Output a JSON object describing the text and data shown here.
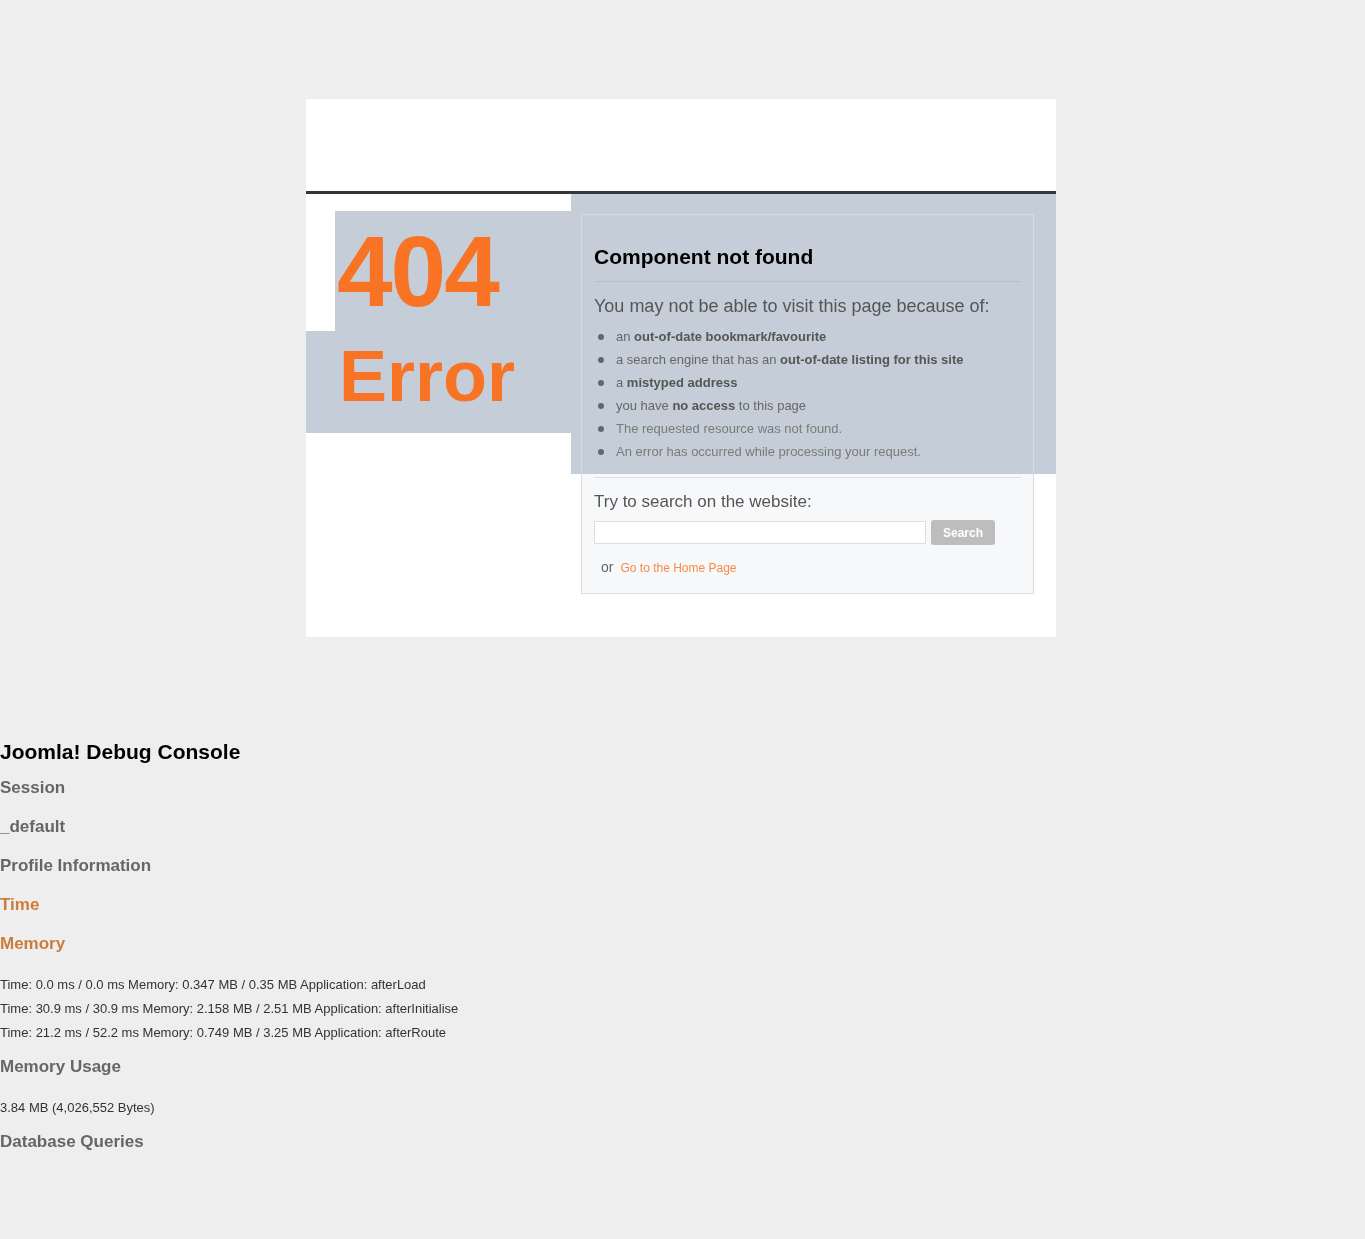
{
  "error": {
    "code": "404",
    "label": "Error"
  },
  "panel": {
    "title": "Component not found",
    "intro": "You may not be able to visit this page because of:",
    "reasons": [
      "an **out-of-date bookmark/favourite**",
      "a search engine that has an **out-of-date listing for this site**",
      "a **mistyped address**",
      "you have **no access** to this page",
      "The requested resource was not found.",
      "An error has occurred while processing your request."
    ],
    "search_prompt": "Try to search on the website:",
    "search_button": "Search",
    "or": "or",
    "home_link": "Go to the Home Page"
  },
  "debug": {
    "title": "Joomla! Debug Console",
    "items": [
      {
        "kind": "heading",
        "text": "Session"
      },
      {
        "kind": "heading",
        "text": "_default"
      },
      {
        "kind": "heading",
        "text": "Profile Information"
      },
      {
        "kind": "link",
        "text": "Time"
      },
      {
        "kind": "link",
        "text": "Memory"
      },
      {
        "kind": "line",
        "text": "Time: 0.0 ms / 0.0 ms Memory: 0.347 MB / 0.35 MB Application: afterLoad"
      },
      {
        "kind": "line",
        "text": "Time: 30.9 ms / 30.9 ms Memory: 2.158 MB / 2.51 MB Application: afterInitialise"
      },
      {
        "kind": "line",
        "text": "Time: 21.2 ms / 52.2 ms Memory: 0.749 MB / 3.25 MB Application: afterRoute"
      },
      {
        "kind": "heading",
        "text": "Memory Usage"
      },
      {
        "kind": "line",
        "text": "3.84 MB (4,026,552 Bytes)"
      },
      {
        "kind": "heading",
        "text": "Database Queries"
      }
    ]
  }
}
